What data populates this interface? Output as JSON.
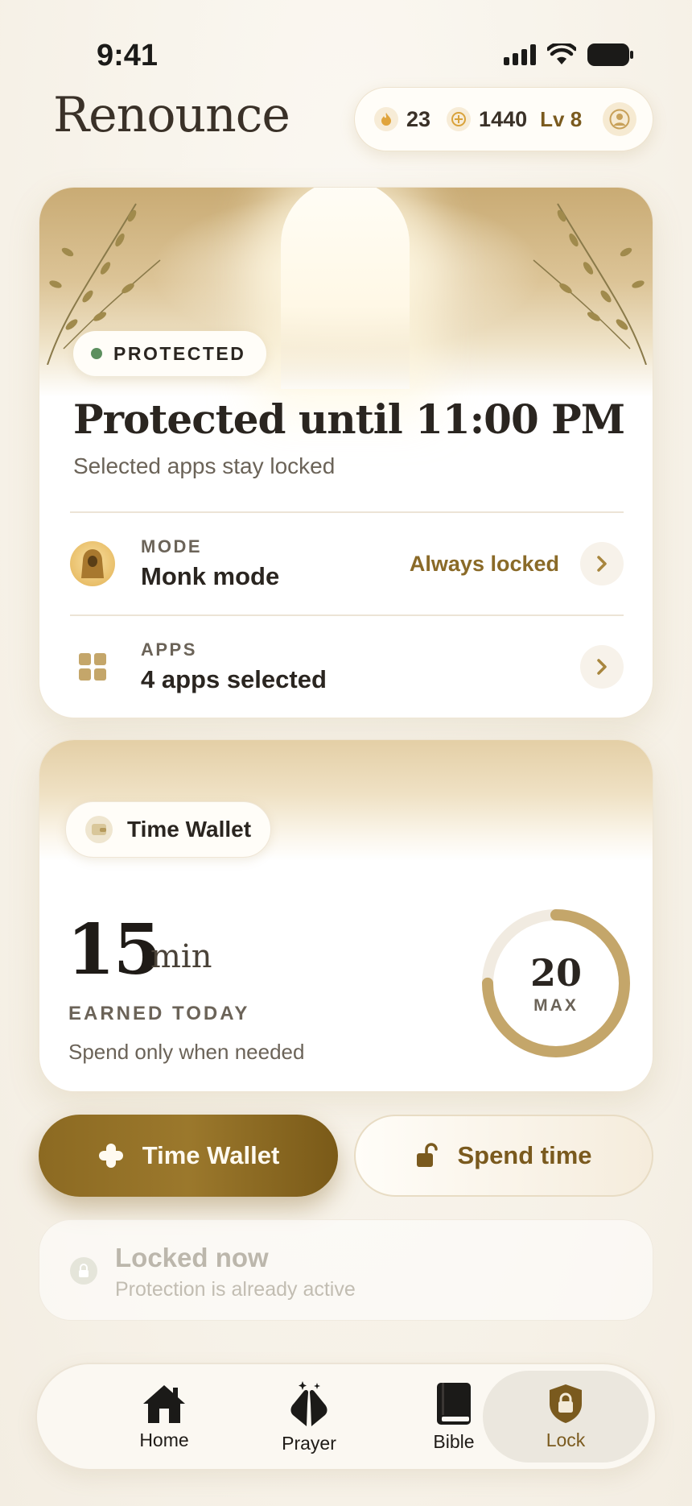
{
  "status_bar": {
    "time": "9:41"
  },
  "header": {
    "app_name": "Renounce",
    "streak": "23",
    "points": "1440",
    "level": "Lv 8"
  },
  "protection": {
    "badge": "PROTECTED",
    "title": "Protected until 11:00 PM",
    "subtitle": "Selected apps stay locked",
    "mode": {
      "label": "MODE",
      "value": "Monk mode",
      "detail": "Always locked"
    },
    "apps": {
      "label": "APPS",
      "value": "4 apps selected"
    }
  },
  "wallet": {
    "badge": "Time Wallet",
    "earned_value": "15",
    "earned_unit": "min",
    "earned_label": "EARNED TODAY",
    "note": "Spend only when needed",
    "max_value": "20",
    "max_label": "MAX",
    "progress_fraction": 0.75
  },
  "actions": {
    "primary": "Time Wallet",
    "secondary": "Spend time"
  },
  "locked_now": {
    "title": "Locked now",
    "subtitle": "Protection is already active"
  },
  "tabs": [
    {
      "label": "Home",
      "icon": "home-icon"
    },
    {
      "label": "Prayer",
      "icon": "praying-hands-icon"
    },
    {
      "label": "Bible",
      "icon": "book-icon"
    },
    {
      "label": "Lock",
      "icon": "shield-lock-icon",
      "active": true
    }
  ],
  "colors": {
    "accent": "#8c6a22",
    "gold": "#c4a66a",
    "protected_dot": "#5c8f5e"
  }
}
